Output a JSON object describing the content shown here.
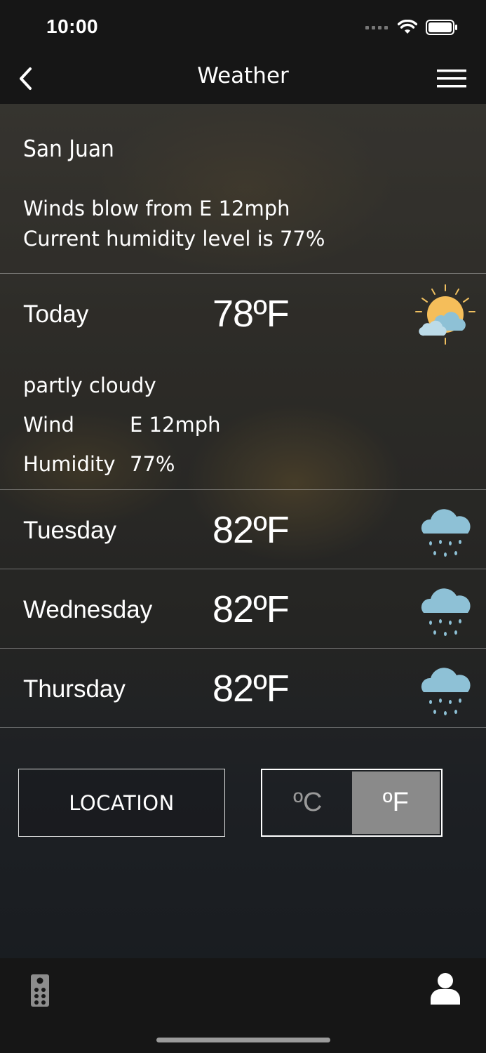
{
  "status": {
    "time": "10:00"
  },
  "nav": {
    "title": "Weather"
  },
  "location": {
    "city": "San Juan",
    "summary_line1": "Winds blow from E 12mph",
    "summary_line2": "Current humidity level is 77%"
  },
  "today": {
    "label": "Today",
    "temp": "78ºF",
    "icon": "partly-cloudy-icon",
    "description": "partly cloudy",
    "wind_label": "Wind",
    "wind_value": "E 12mph",
    "humidity_label": "Humidity",
    "humidity_value": "77%"
  },
  "forecast": [
    {
      "day": "Tuesday",
      "temp": "82ºF",
      "icon": "rain-cloud-icon"
    },
    {
      "day": "Wednesday",
      "temp": "82ºF",
      "icon": "rain-cloud-icon"
    },
    {
      "day": "Thursday",
      "temp": "82ºF",
      "icon": "rain-cloud-icon"
    }
  ],
  "controls": {
    "location_label": "LOCATION",
    "celsius_label": "ºC",
    "fahrenheit_label": "ºF",
    "selected_unit": "F"
  },
  "tabs": [
    {
      "icon": "remote-icon"
    },
    {
      "icon": "profile-icon"
    }
  ]
}
